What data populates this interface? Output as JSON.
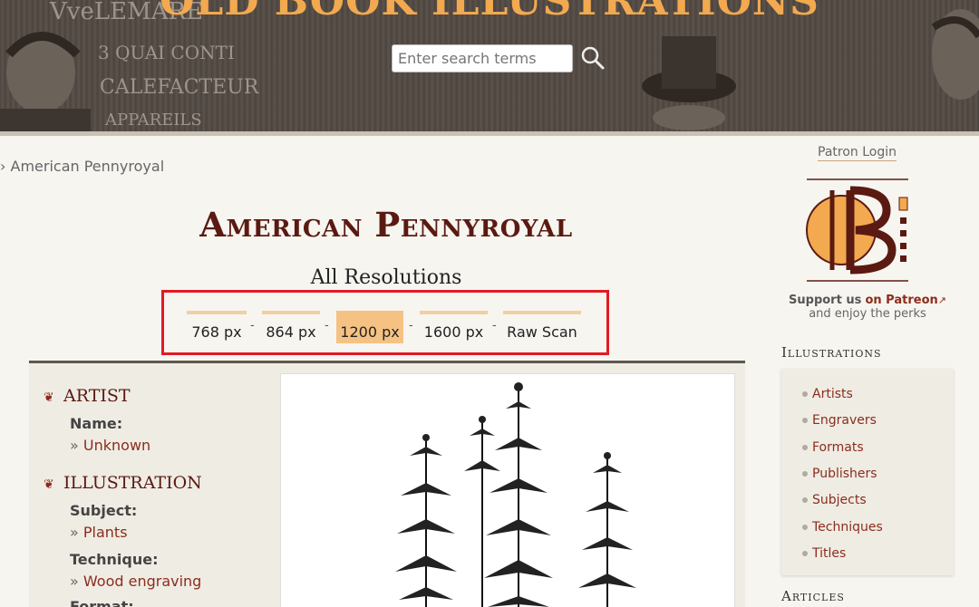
{
  "header": {
    "site_title": "OLD BOOK ILLUSTRATIONS",
    "search_placeholder": "Enter search terms",
    "engraving_text": [
      "VveLEMARE",
      "3 QUAI CONTI",
      "CALEFACTEUR",
      "APPAREILS"
    ]
  },
  "breadcrumb": {
    "current": "American Pennyroyal"
  },
  "page": {
    "title": "American Pennyroyal",
    "resolutions_heading": "All Resolutions",
    "resolutions": [
      {
        "label": "768 px"
      },
      {
        "label": "864 px"
      },
      {
        "label": "1200 px",
        "active": true
      },
      {
        "label": "1600 px"
      },
      {
        "label": "Raw Scan"
      }
    ],
    "separator": "-"
  },
  "details": {
    "artist_heading": "ARTIST",
    "name_label": "Name:",
    "name_value": "Unknown",
    "illustration_heading": "ILLUSTRATION",
    "subject_label": "Subject:",
    "subject_value": "Plants",
    "technique_label": "Technique:",
    "technique_value": "Wood engraving",
    "format_label": "Format:",
    "value_prefix": "»"
  },
  "sidebar": {
    "patron_login": "Patron Login",
    "support_text": "Support us",
    "support_link": "on Patreon",
    "support_sub": "and enjoy the perks",
    "illustrations_heading": "Illustrations",
    "illustrations_items": [
      "Artists",
      "Engravers",
      "Formats",
      "Publishers",
      "Subjects",
      "Techniques",
      "Titles"
    ],
    "articles_heading": "Articles"
  },
  "colors": {
    "accent": "#5a1a12",
    "link": "#8b2d1c",
    "highlight": "#f5c283",
    "title_orange": "#f2a94f",
    "callout_red": "#e21a24"
  }
}
